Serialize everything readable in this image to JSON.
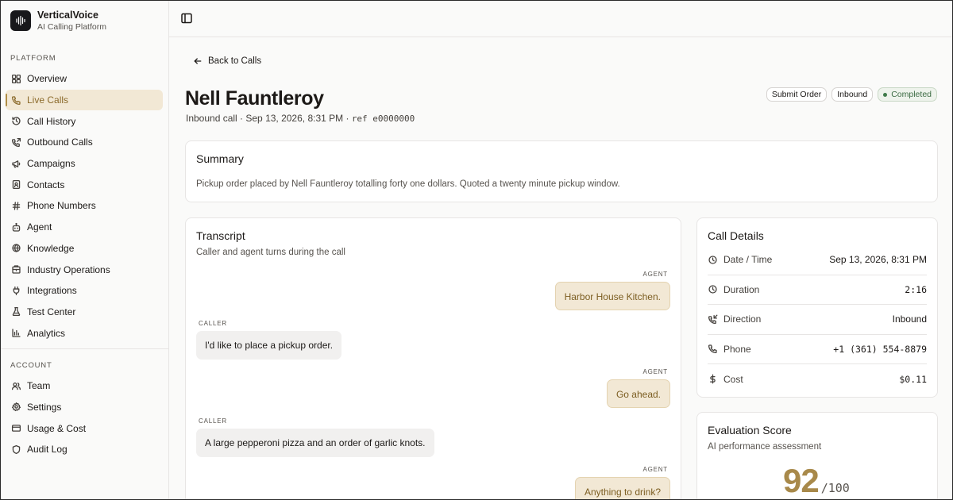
{
  "brand": {
    "name": "VerticalVoice",
    "subtitle": "AI Calling Platform"
  },
  "sidebar": {
    "platform_label": "PLATFORM",
    "platform_items": [
      {
        "label": "Overview",
        "icon": "grid-icon"
      },
      {
        "label": "Live Calls",
        "icon": "phone-icon",
        "active": true
      },
      {
        "label": "Call History",
        "icon": "history-icon"
      },
      {
        "label": "Outbound Calls",
        "icon": "phone-outgoing-icon"
      },
      {
        "label": "Campaigns",
        "icon": "megaphone-icon"
      },
      {
        "label": "Contacts",
        "icon": "contact-card-icon"
      },
      {
        "label": "Phone Numbers",
        "icon": "hash-icon"
      },
      {
        "label": "Agent",
        "icon": "bot-icon"
      },
      {
        "label": "Knowledge",
        "icon": "globe-icon"
      },
      {
        "label": "Industry Operations",
        "icon": "building-icon"
      },
      {
        "label": "Integrations",
        "icon": "plug-icon"
      },
      {
        "label": "Test Center",
        "icon": "flask-icon"
      },
      {
        "label": "Analytics",
        "icon": "bar-chart-icon"
      }
    ],
    "account_label": "ACCOUNT",
    "account_items": [
      {
        "label": "Team",
        "icon": "users-icon"
      },
      {
        "label": "Settings",
        "icon": "gear-icon"
      },
      {
        "label": "Usage & Cost",
        "icon": "credit-card-icon"
      },
      {
        "label": "Audit Log",
        "icon": "shield-icon"
      }
    ]
  },
  "page": {
    "back_label": "Back to Calls",
    "title": "Nell Fauntleroy",
    "subtitle_text": "Inbound call · Sep 13, 2026, 8:31 PM · ",
    "subtitle_ref": "ref e0000000",
    "badges": {
      "type": "Submit Order",
      "direction": "Inbound",
      "status": "Completed"
    }
  },
  "summary": {
    "title": "Summary",
    "text": "Pickup order placed by Nell Fauntleroy totalling forty one dollars. Quoted a twenty minute pickup window."
  },
  "transcript": {
    "title": "Transcript",
    "description": "Caller and agent turns during the call",
    "agent_label": "AGENT",
    "caller_label": "CALLER",
    "turns": [
      {
        "role": "agent",
        "text": "Harbor House Kitchen."
      },
      {
        "role": "caller",
        "text": "I'd like to place a pickup order."
      },
      {
        "role": "agent",
        "text": "Go ahead."
      },
      {
        "role": "caller",
        "text": "A large pepperoni pizza and an order of garlic knots."
      },
      {
        "role": "agent",
        "text": "Anything to drink?"
      }
    ]
  },
  "call_details": {
    "title": "Call Details",
    "rows": [
      {
        "label": "Date / Time",
        "value": "Sep 13, 2026, 8:31 PM",
        "icon": "clock-icon"
      },
      {
        "label": "Duration",
        "value": "2:16",
        "icon": "clock-icon"
      },
      {
        "label": "Direction",
        "value": "Inbound",
        "icon": "phone-incoming-icon"
      },
      {
        "label": "Phone",
        "value": "+1 (361) 554-8879",
        "icon": "phone-icon"
      },
      {
        "label": "Cost",
        "value": "$0.11",
        "icon": "dollar-icon"
      }
    ]
  },
  "evaluation": {
    "title": "Evaluation Score",
    "description": "AI performance assessment",
    "score": "92",
    "out_of": "/100"
  },
  "colors": {
    "accent": "#a8894a",
    "active_bg": "#f2e8d5",
    "completed": "#3f7a4a"
  }
}
